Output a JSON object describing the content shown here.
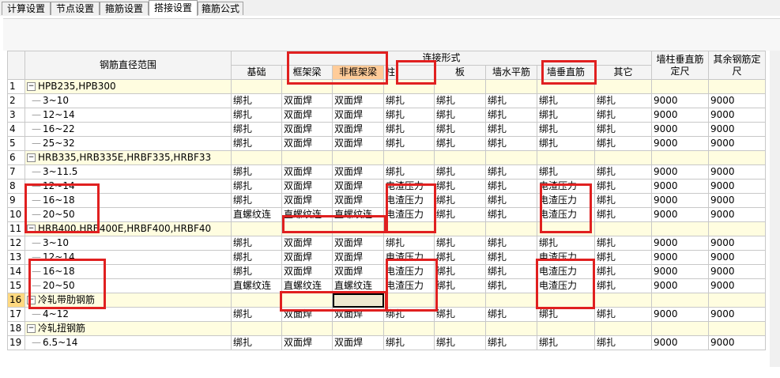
{
  "tabs": [
    {
      "label": "计算设置"
    },
    {
      "label": "节点设置"
    },
    {
      "label": "箍筋设置"
    },
    {
      "label": "搭接设置"
    },
    {
      "label": "箍筋公式"
    }
  ],
  "header": {
    "range": "钢筋直径范围",
    "connection": "连接形式",
    "wall_col_len": "墙柱垂直筋定尺",
    "other_len": "其余钢筋定尺",
    "cols": [
      "基础",
      "框架梁",
      "非框架梁",
      "柱",
      "板",
      "墙水平筋",
      "墙垂直筋",
      "其它"
    ]
  },
  "rows": [
    {
      "n": "1",
      "type": "section",
      "label": "HPB235,HPB300",
      "sign": "−"
    },
    {
      "n": "2",
      "label": "3~10",
      "cells": [
        "绑扎",
        "双面焊",
        "双面焊",
        "绑扎",
        "绑扎",
        "绑扎",
        "绑扎",
        "绑扎",
        "9000",
        "9000"
      ]
    },
    {
      "n": "3",
      "label": "12~14",
      "cells": [
        "绑扎",
        "双面焊",
        "双面焊",
        "绑扎",
        "绑扎",
        "绑扎",
        "绑扎",
        "绑扎",
        "9000",
        "9000"
      ]
    },
    {
      "n": "4",
      "label": "16~22",
      "cells": [
        "绑扎",
        "双面焊",
        "双面焊",
        "绑扎",
        "绑扎",
        "绑扎",
        "绑扎",
        "绑扎",
        "9000",
        "9000"
      ]
    },
    {
      "n": "5",
      "label": "25~32",
      "cells": [
        "绑扎",
        "双面焊",
        "双面焊",
        "绑扎",
        "绑扎",
        "绑扎",
        "绑扎",
        "绑扎",
        "9000",
        "9000"
      ]
    },
    {
      "n": "6",
      "type": "section",
      "label": "HRB335,HRB335E,HRBF335,HRBF33",
      "sign": "−"
    },
    {
      "n": "7",
      "label": "3~11.5",
      "cells": [
        "绑扎",
        "双面焊",
        "双面焊",
        "绑扎",
        "绑扎",
        "绑扎",
        "绑扎",
        "绑扎",
        "9000",
        "9000"
      ]
    },
    {
      "n": "8",
      "label": "12~14",
      "cells": [
        "绑扎",
        "双面焊",
        "双面焊",
        "电渣压力",
        "绑扎",
        "绑扎",
        "电渣压力",
        "绑扎",
        "9000",
        "9000"
      ]
    },
    {
      "n": "9",
      "label": "16~18",
      "cells": [
        "绑扎",
        "双面焊",
        "双面焊",
        "电渣压力",
        "绑扎",
        "绑扎",
        "电渣压力",
        "绑扎",
        "9000",
        "9000"
      ]
    },
    {
      "n": "10",
      "label": "20~50",
      "cells": [
        "直螺纹连",
        "直螺纹连",
        "直螺纹连",
        "电渣压力",
        "绑扎",
        "绑扎",
        "电渣压力",
        "绑扎",
        "9000",
        "9000"
      ]
    },
    {
      "n": "11",
      "type": "section",
      "label": "HRB400,HRB400E,HRBF400,HRBF40",
      "sign": "−"
    },
    {
      "n": "12",
      "label": "3~10",
      "cells": [
        "绑扎",
        "双面焊",
        "双面焊",
        "绑扎",
        "绑扎",
        "绑扎",
        "绑扎",
        "绑扎",
        "9000",
        "9000"
      ]
    },
    {
      "n": "13",
      "label": "12~14",
      "cells": [
        "绑扎",
        "双面焊",
        "双面焊",
        "电渣压力",
        "绑扎",
        "绑扎",
        "电渣压力",
        "绑扎",
        "9000",
        "9000"
      ]
    },
    {
      "n": "14",
      "label": "16~18",
      "cells": [
        "绑扎",
        "双面焊",
        "双面焊",
        "电渣压力",
        "绑扎",
        "绑扎",
        "电渣压力",
        "绑扎",
        "9000",
        "9000"
      ]
    },
    {
      "n": "15",
      "label": "20~50",
      "cells": [
        "直螺纹连",
        "直螺纹连",
        "直螺纹连",
        "电渣压力",
        "绑扎",
        "绑扎",
        "电渣压力",
        "绑扎",
        "9000",
        "9000"
      ]
    },
    {
      "n": "16",
      "type": "section",
      "label": "冷轧带肋钢筋",
      "sign": "−",
      "current": true
    },
    {
      "n": "17",
      "label": "4~12",
      "cells": [
        "绑扎",
        "双面焊",
        "双面焊",
        "绑扎",
        "绑扎",
        "绑扎",
        "绑扎",
        "绑扎",
        "9000",
        "9000"
      ]
    },
    {
      "n": "18",
      "type": "section",
      "label": "冷轧扭钢筋",
      "sign": "−"
    },
    {
      "n": "19",
      "label": "6.5~14",
      "cells": [
        "绑扎",
        "双面焊",
        "双面焊",
        "绑扎",
        "绑扎",
        "绑扎",
        "绑扎",
        "绑扎",
        "9000",
        "9000"
      ]
    }
  ],
  "colors": {
    "highlight": "#e02020",
    "section_bg": "#fffde0",
    "current_row": "#ffd980",
    "header_orange": "#ffcc99"
  }
}
